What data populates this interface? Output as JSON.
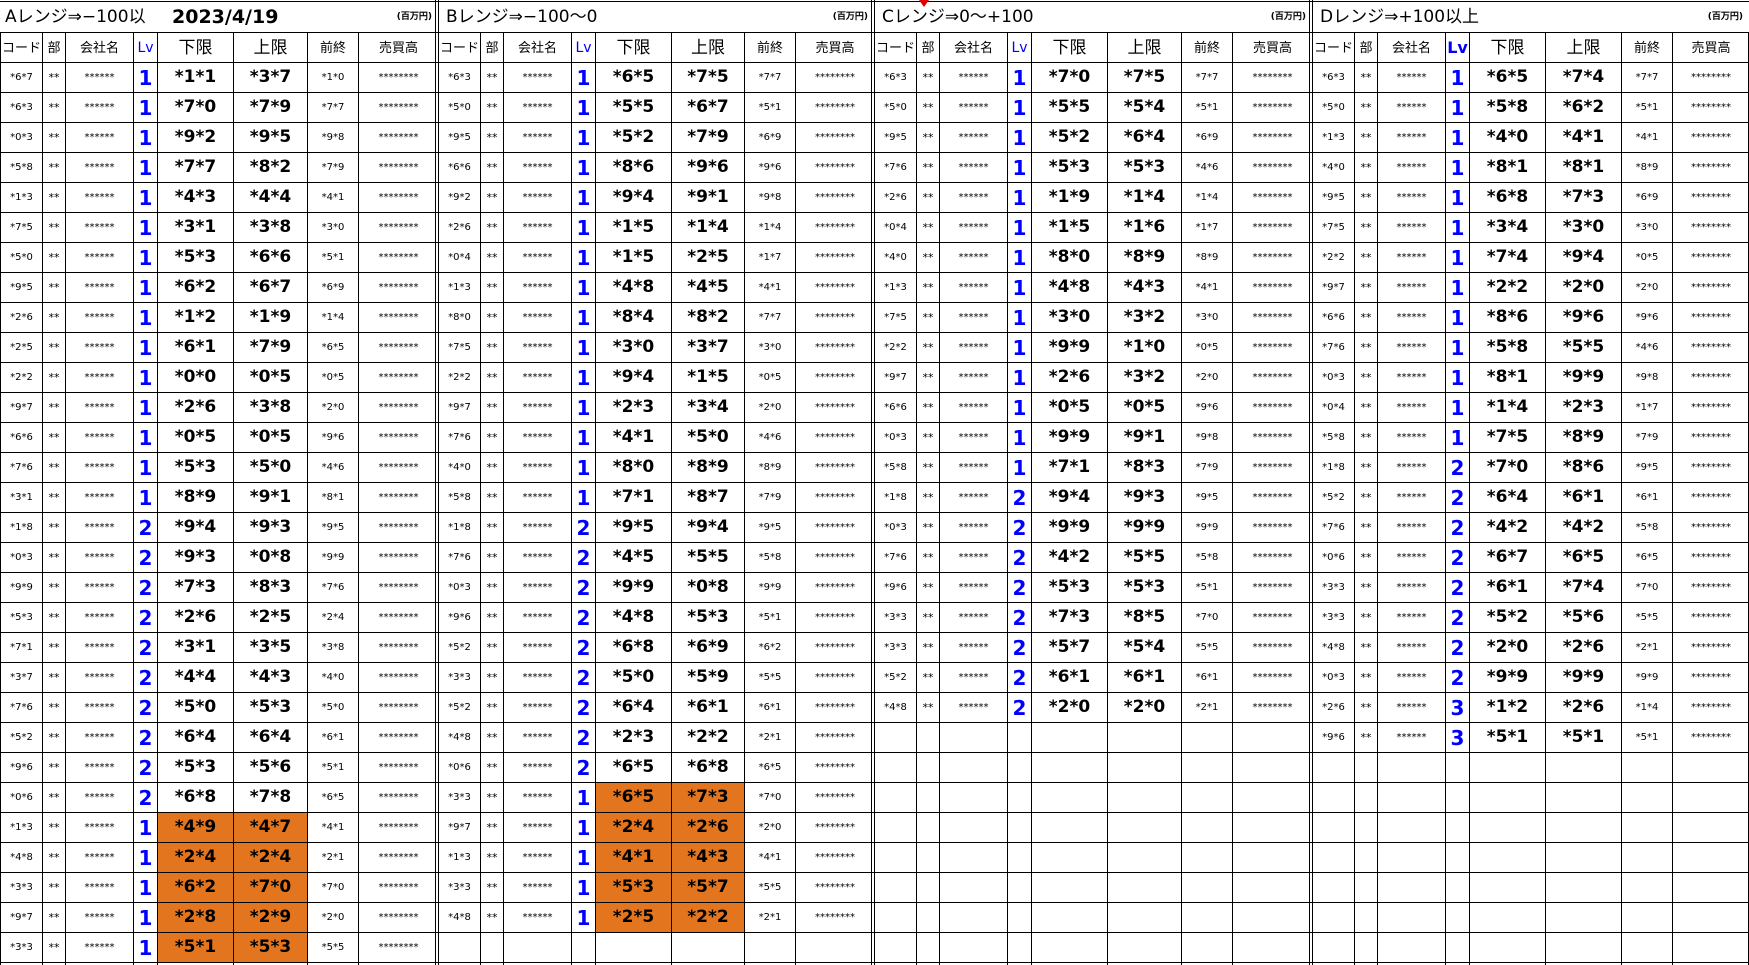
{
  "sheet": {
    "date": "2023/4/19",
    "unit_label": "(百万円)",
    "headers": {
      "code": "コード",
      "dept": "部",
      "company": "会社名",
      "lv": "Lv",
      "lower": "下限",
      "upper": "上限",
      "prev_close": "前終",
      "sales": "売買高"
    },
    "placeholders": {
      "dept": "**",
      "company": "******",
      "sales": "********"
    },
    "accent_colors": {
      "level_blue": "#0000ff",
      "highlight_orange": "#e2751e",
      "comment_marker_red": "#e00000"
    },
    "blocks": [
      {
        "title": "Aレンジ⇒−100以",
        "rows": [
          [
            "*6*7",
            "1",
            "*1*1",
            "*3*7",
            "*1*0",
            false
          ],
          [
            "*6*3",
            "1",
            "*7*0",
            "*7*9",
            "*7*7",
            false
          ],
          [
            "*0*3",
            "1",
            "*9*2",
            "*9*5",
            "*9*8",
            false
          ],
          [
            "*5*8",
            "1",
            "*7*7",
            "*8*2",
            "*7*9",
            false
          ],
          [
            "*1*3",
            "1",
            "*4*3",
            "*4*4",
            "*4*1",
            false
          ],
          [
            "*7*5",
            "1",
            "*3*1",
            "*3*8",
            "*3*0",
            false
          ],
          [
            "*5*0",
            "1",
            "*5*3",
            "*6*6",
            "*5*1",
            false
          ],
          [
            "*9*5",
            "1",
            "*6*2",
            "*6*7",
            "*6*9",
            false
          ],
          [
            "*2*6",
            "1",
            "*1*2",
            "*1*9",
            "*1*4",
            false
          ],
          [
            "*2*5",
            "1",
            "*6*1",
            "*7*9",
            "*6*5",
            false
          ],
          [
            "*2*2",
            "1",
            "*0*0",
            "*0*5",
            "*0*5",
            false
          ],
          [
            "*9*7",
            "1",
            "*2*6",
            "*3*8",
            "*2*0",
            false
          ],
          [
            "*6*6",
            "1",
            "*0*5",
            "*0*5",
            "*9*6",
            false
          ],
          [
            "*7*6",
            "1",
            "*5*3",
            "*5*0",
            "*4*6",
            false
          ],
          [
            "*3*1",
            "1",
            "*8*9",
            "*9*1",
            "*8*1",
            false
          ],
          [
            "*1*8",
            "2",
            "*9*4",
            "*9*3",
            "*9*5",
            false
          ],
          [
            "*0*3",
            "2",
            "*9*3",
            "*0*8",
            "*9*9",
            false
          ],
          [
            "*9*9",
            "2",
            "*7*3",
            "*8*3",
            "*7*6",
            false
          ],
          [
            "*5*3",
            "2",
            "*2*6",
            "*2*5",
            "*2*4",
            false
          ],
          [
            "*7*1",
            "2",
            "*3*1",
            "*3*5",
            "*3*8",
            false
          ],
          [
            "*3*7",
            "2",
            "*4*4",
            "*4*3",
            "*4*0",
            false
          ],
          [
            "*7*6",
            "2",
            "*5*0",
            "*5*3",
            "*5*0",
            false
          ],
          [
            "*5*2",
            "2",
            "*6*4",
            "*6*4",
            "*6*1",
            false
          ],
          [
            "*9*6",
            "2",
            "*5*3",
            "*5*6",
            "*5*1",
            false
          ],
          [
            "*0*6",
            "2",
            "*6*8",
            "*7*8",
            "*6*5",
            false
          ],
          [
            "*1*3",
            "1",
            "*4*9",
            "*4*7",
            "*4*1",
            true
          ],
          [
            "*4*8",
            "1",
            "*2*4",
            "*2*4",
            "*2*1",
            true
          ],
          [
            "*3*3",
            "1",
            "*6*2",
            "*7*0",
            "*7*0",
            true
          ],
          [
            "*9*7",
            "1",
            "*2*8",
            "*2*9",
            "*2*0",
            true
          ],
          [
            "*3*3",
            "1",
            "*5*1",
            "*5*3",
            "*5*5",
            true
          ]
        ]
      },
      {
        "title": "Bレンジ⇒−100〜0",
        "rows": [
          [
            "*6*3",
            "1",
            "*6*5",
            "*7*5",
            "*7*7",
            false
          ],
          [
            "*5*0",
            "1",
            "*5*5",
            "*6*7",
            "*5*1",
            false
          ],
          [
            "*9*5",
            "1",
            "*5*2",
            "*7*9",
            "*6*9",
            false
          ],
          [
            "*6*6",
            "1",
            "*8*6",
            "*9*6",
            "*9*6",
            false
          ],
          [
            "*9*2",
            "1",
            "*9*4",
            "*9*1",
            "*9*8",
            false
          ],
          [
            "*2*6",
            "1",
            "*1*5",
            "*1*4",
            "*1*4",
            false
          ],
          [
            "*0*4",
            "1",
            "*1*5",
            "*2*5",
            "*1*7",
            false
          ],
          [
            "*1*3",
            "1",
            "*4*8",
            "*4*5",
            "*4*1",
            false
          ],
          [
            "*8*0",
            "1",
            "*8*4",
            "*8*2",
            "*7*7",
            false
          ],
          [
            "*7*5",
            "1",
            "*3*0",
            "*3*7",
            "*3*0",
            false
          ],
          [
            "*2*2",
            "1",
            "*9*4",
            "*1*5",
            "*0*5",
            false
          ],
          [
            "*9*7",
            "1",
            "*2*3",
            "*3*4",
            "*2*0",
            false
          ],
          [
            "*7*6",
            "1",
            "*4*1",
            "*5*0",
            "*4*6",
            false
          ],
          [
            "*4*0",
            "1",
            "*8*0",
            "*8*9",
            "*8*9",
            false
          ],
          [
            "*5*8",
            "1",
            "*7*1",
            "*8*7",
            "*7*9",
            false
          ],
          [
            "*1*8",
            "2",
            "*9*5",
            "*9*4",
            "*9*5",
            false
          ],
          [
            "*7*6",
            "2",
            "*4*5",
            "*5*5",
            "*5*8",
            false
          ],
          [
            "*0*3",
            "2",
            "*9*9",
            "*0*8",
            "*9*9",
            false
          ],
          [
            "*9*6",
            "2",
            "*4*8",
            "*5*3",
            "*5*1",
            false
          ],
          [
            "*5*2",
            "2",
            "*6*8",
            "*6*9",
            "*6*2",
            false
          ],
          [
            "*3*3",
            "2",
            "*5*0",
            "*5*9",
            "*5*5",
            false
          ],
          [
            "*5*2",
            "2",
            "*6*4",
            "*6*1",
            "*6*1",
            false
          ],
          [
            "*4*8",
            "2",
            "*2*3",
            "*2*2",
            "*2*1",
            false
          ],
          [
            "*0*6",
            "2",
            "*6*5",
            "*6*8",
            "*6*5",
            false
          ],
          [
            "*3*3",
            "1",
            "*6*5",
            "*7*3",
            "*7*0",
            true
          ],
          [
            "*9*7",
            "1",
            "*2*4",
            "*2*6",
            "*2*0",
            true
          ],
          [
            "*1*3",
            "1",
            "*4*1",
            "*4*3",
            "*4*1",
            true
          ],
          [
            "*3*3",
            "1",
            "*5*3",
            "*5*7",
            "*5*5",
            true
          ],
          [
            "*4*8",
            "1",
            "*2*5",
            "*2*2",
            "*2*1",
            true
          ]
        ]
      },
      {
        "title": "Cレンジ⇒0〜+100",
        "rows": [
          [
            "*6*3",
            "1",
            "*7*0",
            "*7*5",
            "*7*7",
            false
          ],
          [
            "*5*0",
            "1",
            "*5*5",
            "*5*4",
            "*5*1",
            false
          ],
          [
            "*9*5",
            "1",
            "*5*2",
            "*6*4",
            "*6*9",
            false
          ],
          [
            "*7*6",
            "1",
            "*5*3",
            "*5*3",
            "*4*6",
            false
          ],
          [
            "*2*6",
            "1",
            "*1*9",
            "*1*4",
            "*1*4",
            false
          ],
          [
            "*0*4",
            "1",
            "*1*5",
            "*1*6",
            "*1*7",
            false
          ],
          [
            "*4*0",
            "1",
            "*8*0",
            "*8*9",
            "*8*9",
            false
          ],
          [
            "*1*3",
            "1",
            "*4*8",
            "*4*3",
            "*4*1",
            false
          ],
          [
            "*7*5",
            "1",
            "*3*0",
            "*3*2",
            "*3*0",
            false
          ],
          [
            "*2*2",
            "1",
            "*9*9",
            "*1*0",
            "*0*5",
            false
          ],
          [
            "*9*7",
            "1",
            "*2*6",
            "*3*2",
            "*2*0",
            false
          ],
          [
            "*6*6",
            "1",
            "*0*5",
            "*0*5",
            "*9*6",
            false
          ],
          [
            "*0*3",
            "1",
            "*9*9",
            "*9*1",
            "*9*8",
            false
          ],
          [
            "*5*8",
            "1",
            "*7*1",
            "*8*3",
            "*7*9",
            false
          ],
          [
            "*1*8",
            "2",
            "*9*4",
            "*9*3",
            "*9*5",
            false
          ],
          [
            "*0*3",
            "2",
            "*9*9",
            "*9*9",
            "*9*9",
            false
          ],
          [
            "*7*6",
            "2",
            "*4*2",
            "*5*5",
            "*5*8",
            false
          ],
          [
            "*9*6",
            "2",
            "*5*3",
            "*5*3",
            "*5*1",
            false
          ],
          [
            "*3*3",
            "2",
            "*7*3",
            "*8*5",
            "*7*0",
            false
          ],
          [
            "*3*3",
            "2",
            "*5*7",
            "*5*4",
            "*5*5",
            false
          ],
          [
            "*5*2",
            "2",
            "*6*1",
            "*6*1",
            "*6*1",
            false
          ],
          [
            "*4*8",
            "2",
            "*2*0",
            "*2*0",
            "*2*1",
            false
          ]
        ]
      },
      {
        "title": "Dレンジ⇒+100以上",
        "rows": [
          [
            "*6*3",
            "1",
            "*6*5",
            "*7*4",
            "*7*7",
            false
          ],
          [
            "*5*0",
            "1",
            "*5*8",
            "*6*2",
            "*5*1",
            false
          ],
          [
            "*1*3",
            "1",
            "*4*0",
            "*4*1",
            "*4*1",
            false
          ],
          [
            "*4*0",
            "1",
            "*8*1",
            "*8*1",
            "*8*9",
            false
          ],
          [
            "*9*5",
            "1",
            "*6*8",
            "*7*3",
            "*6*9",
            false
          ],
          [
            "*7*5",
            "1",
            "*3*4",
            "*3*0",
            "*3*0",
            false
          ],
          [
            "*2*2",
            "1",
            "*7*4",
            "*9*4",
            "*0*5",
            false
          ],
          [
            "*9*7",
            "1",
            "*2*2",
            "*2*0",
            "*2*0",
            false
          ],
          [
            "*6*6",
            "1",
            "*8*6",
            "*9*6",
            "*9*6",
            false
          ],
          [
            "*7*6",
            "1",
            "*5*8",
            "*5*5",
            "*4*6",
            false
          ],
          [
            "*0*3",
            "1",
            "*8*1",
            "*9*9",
            "*9*8",
            false
          ],
          [
            "*0*4",
            "1",
            "*1*4",
            "*2*3",
            "*1*7",
            false
          ],
          [
            "*5*8",
            "1",
            "*7*5",
            "*8*9",
            "*7*9",
            false
          ],
          [
            "*1*8",
            "2",
            "*7*0",
            "*8*6",
            "*9*5",
            false
          ],
          [
            "*5*2",
            "2",
            "*6*4",
            "*6*1",
            "*6*1",
            false
          ],
          [
            "*7*6",
            "2",
            "*4*2",
            "*4*2",
            "*5*8",
            false
          ],
          [
            "*0*6",
            "2",
            "*6*7",
            "*6*5",
            "*6*5",
            false
          ],
          [
            "*3*3",
            "2",
            "*6*1",
            "*7*4",
            "*7*0",
            false
          ],
          [
            "*3*3",
            "2",
            "*5*2",
            "*5*6",
            "*5*5",
            false
          ],
          [
            "*4*8",
            "2",
            "*2*0",
            "*2*6",
            "*2*1",
            false
          ],
          [
            "*0*3",
            "2",
            "*9*9",
            "*9*9",
            "*9*9",
            false
          ],
          [
            "*2*6",
            "3",
            "*1*2",
            "*2*6",
            "*1*4",
            false
          ],
          [
            "*9*6",
            "3",
            "*5*1",
            "*5*1",
            "*5*1",
            false
          ]
        ]
      }
    ]
  }
}
